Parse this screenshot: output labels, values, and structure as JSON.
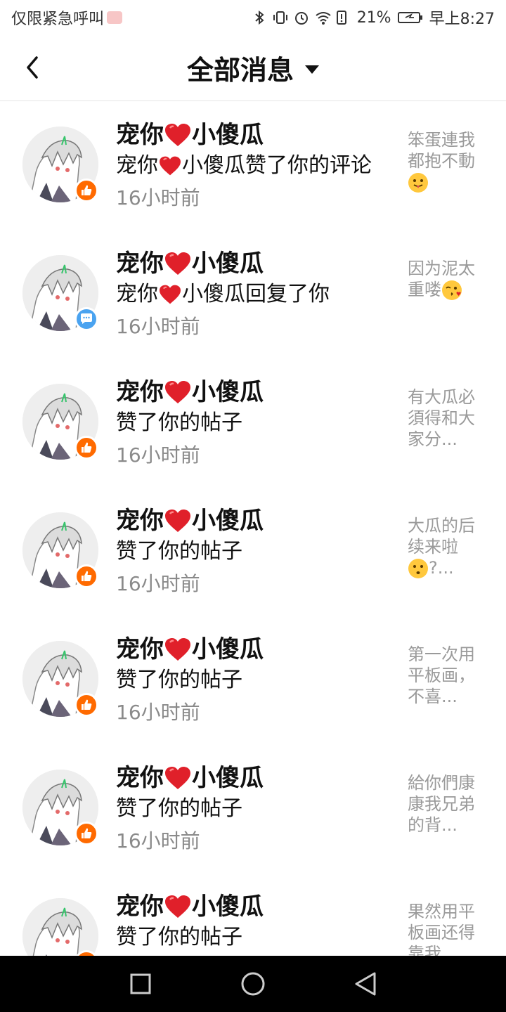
{
  "status_bar": {
    "left_text": "仅限紧急呼叫",
    "battery_percent": "21%",
    "clock": "早上8:27",
    "icons": [
      "bluetooth-icon",
      "vibrate-icon",
      "alarm-icon",
      "wifi-icon",
      "battery-alert-icon",
      "battery-icon"
    ]
  },
  "header": {
    "title": "全部消息",
    "back_icon": "chevron-left-icon",
    "dropdown_icon": "caret-down-icon"
  },
  "colors": {
    "like_badge": "#ff6a00",
    "reply_badge": "#4aa3f0",
    "heart": "#e0202a",
    "time_text": "#8a8a8a",
    "preview_text": "#9a9a9a"
  },
  "notifications": [
    {
      "name": "宠你❤️小傻瓜",
      "message": "宠你❤️小傻瓜赞了你的评论",
      "time": "16小时前",
      "badge": "like",
      "preview_line1": "笨蛋連我",
      "preview_line2": "都抱不動",
      "preview_line3": "😛"
    },
    {
      "name": "宠你❤️小傻瓜",
      "message": "宠你❤️小傻瓜回复了你",
      "time": "16小时前",
      "badge": "reply",
      "preview_line1": "因为泥太",
      "preview_line2": "重喽😘",
      "preview_line3": ""
    },
    {
      "name": "宠你❤️小傻瓜",
      "message": "赞了你的帖子",
      "time": "16小时前",
      "badge": "like",
      "preview_line1": "有大瓜必",
      "preview_line2": "須得和大",
      "preview_line3": "家分..."
    },
    {
      "name": "宠你❤️小傻瓜",
      "message": "赞了你的帖子",
      "time": "16小时前",
      "badge": "like",
      "preview_line1": "大瓜的后",
      "preview_line2": "续来啦",
      "preview_line3": "😗?..."
    },
    {
      "name": "宠你❤️小傻瓜",
      "message": "赞了你的帖子",
      "time": "16小时前",
      "badge": "like",
      "preview_line1": "第一次用",
      "preview_line2": "平板画，",
      "preview_line3": "不喜..."
    },
    {
      "name": "宠你❤️小傻瓜",
      "message": "赞了你的帖子",
      "time": "16小时前",
      "badge": "like",
      "preview_line1": "給你們康",
      "preview_line2": "康我兄弟",
      "preview_line3": "的背..."
    },
    {
      "name": "宠你❤️小傻瓜",
      "message": "赞了你的帖子",
      "time": "",
      "badge": "like",
      "preview_line1": "果然用平",
      "preview_line2": "板画还得",
      "preview_line3": "靠我..."
    }
  ],
  "nav_bar": {
    "buttons": [
      "recent-apps-icon",
      "home-icon",
      "back-icon"
    ]
  }
}
